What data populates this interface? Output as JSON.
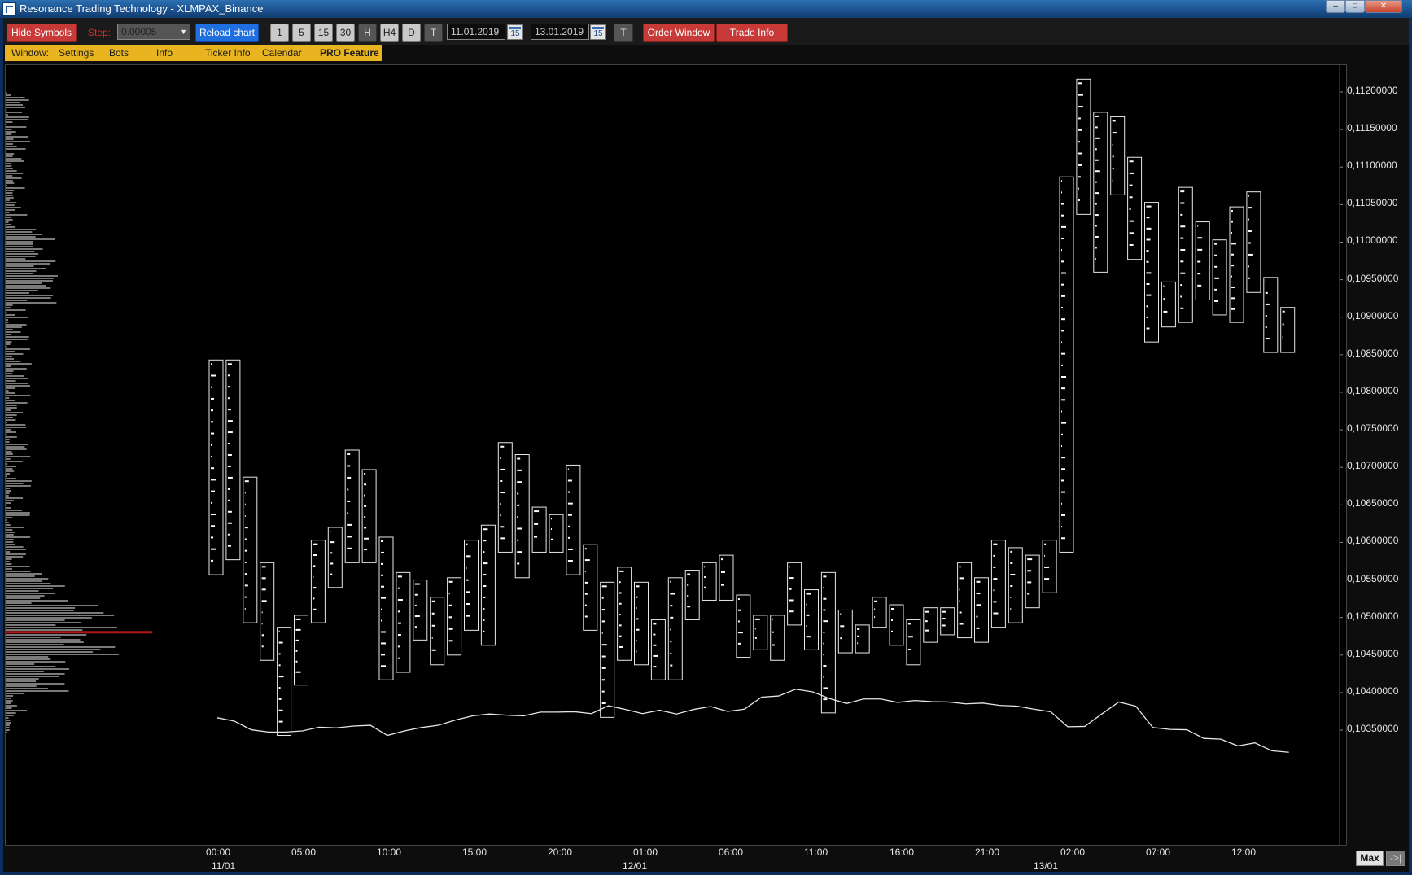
{
  "window": {
    "title": "Resonance Trading Technology - XLMPAX_Binance",
    "minimize": "–",
    "maximize": "□",
    "close": "✕"
  },
  "toolbar": {
    "hide_symbols": "Hide Symbols",
    "step_label": "Step:",
    "step_value": "0.00005",
    "reload_chart": "Reload chart",
    "timeframes": [
      "1",
      "5",
      "15",
      "30",
      "H",
      "H4",
      "D",
      "T"
    ],
    "date_from": "11.01.2019",
    "date_to": "13.01.2019",
    "calendar_icon_label": "15",
    "t_button": "T",
    "order_window": "Order Window",
    "trade_info": "Trade Info"
  },
  "menu": {
    "window": "Window:",
    "settings": "Settings",
    "bots": "Bots",
    "info": "Info",
    "ticker_info": "Ticker Info",
    "calendar": "Calendar",
    "pro_feature": "PRO Feature"
  },
  "chart_data": {
    "type": "candlestick-volume-profile",
    "symbol": "XLMPAX_Binance",
    "ylim": [
      0.1032,
      0.11225
    ],
    "y_ticks": [
      "0,11200000",
      "0,11150000",
      "0,11100000",
      "0,11050000",
      "0,11000000",
      "0,10950000",
      "0,10900000",
      "0,10850000",
      "0,10800000",
      "0,10750000",
      "0,10700000",
      "0,10650000",
      "0,10600000",
      "0,10550000",
      "0,10500000",
      "0,10450000",
      "0,10400000",
      "0,10350000"
    ],
    "y_tick_values": [
      0.112,
      0.1115,
      0.111,
      0.1105,
      0.11,
      0.1095,
      0.109,
      0.1085,
      0.108,
      0.1075,
      0.107,
      0.1065,
      0.106,
      0.1055,
      0.105,
      0.1045,
      0.104,
      0.1035
    ],
    "x_ticks": [
      "00:00",
      "05:00",
      "10:00",
      "15:00",
      "20:00",
      "01:00",
      "06:00",
      "11:00",
      "16:00",
      "21:00",
      "02:00",
      "07:00",
      "12:00"
    ],
    "date_ticks": [
      "11/01",
      "12/01",
      "13/01"
    ],
    "bars_hl": [
      [
        0.10843,
        0.10557
      ],
      [
        0.10843,
        0.10577
      ],
      [
        0.10687,
        0.10493
      ],
      [
        0.10573,
        0.10443
      ],
      [
        0.10487,
        0.10343
      ],
      [
        0.10503,
        0.1041
      ],
      [
        0.10603,
        0.10493
      ],
      [
        0.1062,
        0.1054
      ],
      [
        0.10723,
        0.10573
      ],
      [
        0.10697,
        0.10573
      ],
      [
        0.10607,
        0.10417
      ],
      [
        0.1056,
        0.10427
      ],
      [
        0.1055,
        0.1047
      ],
      [
        0.10527,
        0.10437
      ],
      [
        0.10553,
        0.1045
      ],
      [
        0.10603,
        0.10483
      ],
      [
        0.10623,
        0.10463
      ],
      [
        0.10733,
        0.10587
      ],
      [
        0.10717,
        0.10553
      ],
      [
        0.10647,
        0.10587
      ],
      [
        0.10637,
        0.10587
      ],
      [
        0.10703,
        0.10557
      ],
      [
        0.10597,
        0.10483
      ],
      [
        0.10547,
        0.10367
      ],
      [
        0.10567,
        0.10443
      ],
      [
        0.10547,
        0.10437
      ],
      [
        0.10497,
        0.10417
      ],
      [
        0.10553,
        0.10417
      ],
      [
        0.10563,
        0.10497
      ],
      [
        0.10573,
        0.10523
      ],
      [
        0.10583,
        0.10523
      ],
      [
        0.1053,
        0.10447
      ],
      [
        0.10503,
        0.10457
      ],
      [
        0.10503,
        0.10443
      ],
      [
        0.10573,
        0.1049
      ],
      [
        0.10537,
        0.10457
      ],
      [
        0.1056,
        0.10373
      ],
      [
        0.1051,
        0.10453
      ],
      [
        0.1049,
        0.10453
      ],
      [
        0.10527,
        0.10487
      ],
      [
        0.10517,
        0.10463
      ],
      [
        0.10497,
        0.10437
      ],
      [
        0.10513,
        0.10467
      ],
      [
        0.10513,
        0.10477
      ],
      [
        0.10573,
        0.10473
      ],
      [
        0.10553,
        0.10467
      ],
      [
        0.10603,
        0.10487
      ],
      [
        0.10593,
        0.10493
      ],
      [
        0.10583,
        0.10513
      ],
      [
        0.10603,
        0.10533
      ],
      [
        0.11087,
        0.10587
      ],
      [
        0.11217,
        0.11037
      ],
      [
        0.11173,
        0.1096
      ],
      [
        0.11167,
        0.11063
      ],
      [
        0.11113,
        0.10977
      ],
      [
        0.11053,
        0.10867
      ],
      [
        0.10947,
        0.10887
      ],
      [
        0.11073,
        0.10893
      ],
      [
        0.11027,
        0.10923
      ],
      [
        0.11003,
        0.10903
      ],
      [
        0.11047,
        0.10893
      ],
      [
        0.11067,
        0.10933
      ],
      [
        0.10953,
        0.10853
      ],
      [
        0.10913,
        0.10853
      ]
    ],
    "volume_line": [
      0.103665,
      0.10362,
      0.103505,
      0.103475,
      0.103475,
      0.10349,
      0.10354,
      0.10353,
      0.103555,
      0.103565,
      0.10343,
      0.10349,
      0.103535,
      0.103565,
      0.103635,
      0.10369,
      0.103715,
      0.1037,
      0.10369,
      0.10374,
      0.10374,
      0.103745,
      0.10372,
      0.103825,
      0.103775,
      0.10372,
      0.103765,
      0.103715,
      0.103775,
      0.103815,
      0.10375,
      0.10378,
      0.10394,
      0.103955,
      0.104045,
      0.10401,
      0.10392,
      0.103855,
      0.103915,
      0.103915,
      0.10387,
      0.103895,
      0.10388,
      0.103875,
      0.10385,
      0.10386,
      0.10383,
      0.10382,
      0.10378,
      0.103745,
      0.103545,
      0.10355,
      0.103715,
      0.103875,
      0.10382,
      0.103535,
      0.10351,
      0.103505,
      0.10339,
      0.10338,
      0.10329,
      0.10333,
      0.103225,
      0.103205
    ]
  },
  "bottom": {
    "max_button": "Max",
    "scroll_button": "->|"
  }
}
